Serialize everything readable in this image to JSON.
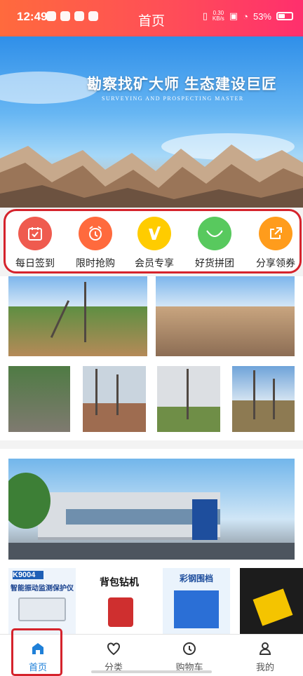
{
  "status_bar": {
    "time": "12:49",
    "network_speed_value": "0.30",
    "network_speed_unit": "KB/s",
    "battery": "53%"
  },
  "header": {
    "title": "首页"
  },
  "banner": {
    "title": "勘察找矿大师  生态建设巨匠",
    "subtitle": "SURVEYING AND PROSPECTING MASTER"
  },
  "quick_nav": [
    {
      "label": "每日签到",
      "icon": "calendar-check-icon",
      "color": "#ef5b4f"
    },
    {
      "label": "限时抢购",
      "icon": "alarm-clock-icon",
      "color": "#ff6a3d"
    },
    {
      "label": "会员专享",
      "icon": "v-badge-icon",
      "color": "#ffcc00"
    },
    {
      "label": "好货拼团",
      "icon": "smile-bag-icon",
      "color": "#58c95e"
    },
    {
      "label": "分享领券",
      "icon": "share-icon",
      "color": "#ff9c1c"
    }
  ],
  "products": [
    {
      "title": "K9004",
      "subtitle": "智能振动监测保护仪"
    },
    {
      "title": "背包钻机"
    },
    {
      "title": "彩钢围档"
    },
    {
      "title": ""
    }
  ],
  "tab_bar": [
    {
      "label": "首页",
      "icon": "home-icon",
      "active": true
    },
    {
      "label": "分类",
      "icon": "heart-icon"
    },
    {
      "label": "购物车",
      "icon": "clock-icon"
    },
    {
      "label": "我的",
      "icon": "user-icon"
    }
  ],
  "colors": {
    "header_start": "#ff6a3d",
    "header_end": "#ff2f6d",
    "highlight": "#d5232c",
    "active_tab": "#1f80d8"
  }
}
